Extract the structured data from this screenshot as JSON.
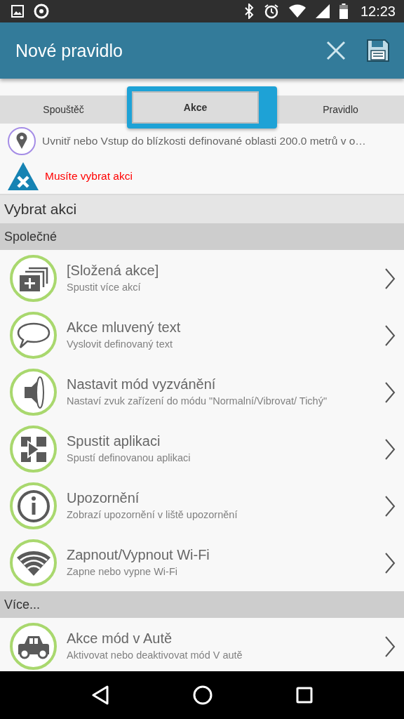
{
  "status_bar": {
    "time": "12:23"
  },
  "app_bar": {
    "title": "Nové pravidlo"
  },
  "tabs": [
    {
      "label": "Spouštěč",
      "selected": false
    },
    {
      "label": "Akce",
      "selected": true
    },
    {
      "label": "Pravidlo",
      "selected": false
    }
  ],
  "summary": [
    {
      "kind": "location",
      "text": "Uvnitř nebo Vstup do blízkosti definované oblasti 200.0 metrů v o…",
      "error": false
    },
    {
      "kind": "warning",
      "text": "Musíte vybrat akci",
      "error": true
    }
  ],
  "section_title": "Vybrat akci",
  "groups": [
    {
      "title": "Společné",
      "items": [
        {
          "kind": "stack",
          "title": "[Složená akce]",
          "subtitle": "Spustit více akcí"
        },
        {
          "kind": "speech",
          "title": "Akce mluvený text",
          "subtitle": "Vyslovit definovaný text"
        },
        {
          "kind": "speaker",
          "title": "Nastavit mód vyzvánění",
          "subtitle": "Nastaví zvuk zařízení do módu \"Normalní/Vibrovat/ Tichý\""
        },
        {
          "kind": "app",
          "title": "Spustit aplikaci",
          "subtitle": "Spustí definovanou aplikaci"
        },
        {
          "kind": "info",
          "title": "Upozornění",
          "subtitle": "Zobrazí upozornění v liště upozornění"
        },
        {
          "kind": "wifi",
          "title": "Zapnout/Vypnout Wi-Fi",
          "subtitle": "Zapne nebo vypne Wi-Fi"
        }
      ]
    },
    {
      "title": "Více...",
      "items": [
        {
          "kind": "car",
          "title": "Akce mód v Autě",
          "subtitle": "Aktivovat nebo deaktivovat mód V autě"
        }
      ]
    }
  ]
}
